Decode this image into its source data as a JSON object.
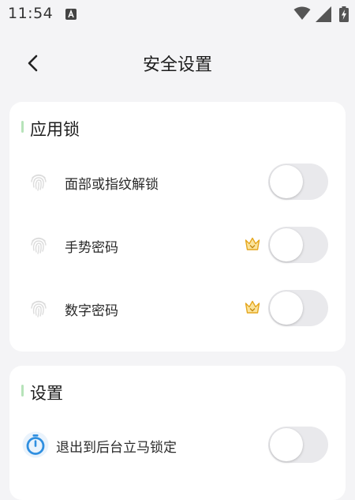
{
  "status_bar": {
    "time": "11:54",
    "icons": [
      "a-notification-icon",
      "wifi-icon",
      "cell-signal-icon",
      "battery-charging-icon"
    ]
  },
  "header": {
    "title": "安全设置",
    "back_icon": "chevron-left-icon"
  },
  "app_lock_section": {
    "title": "应用锁",
    "items": [
      {
        "label": "面部或指纹解锁",
        "icon": "fingerprint-icon",
        "premium": false,
        "enabled": false
      },
      {
        "label": "手势密码",
        "icon": "fingerprint-icon",
        "premium": true,
        "enabled": false
      },
      {
        "label": "数字密码",
        "icon": "fingerprint-icon",
        "premium": true,
        "enabled": false
      }
    ]
  },
  "settings_section": {
    "title": "设置",
    "items": [
      {
        "label": "退出到后台立马锁定",
        "icon": "stopwatch-icon",
        "enabled": false
      }
    ]
  },
  "colors": {
    "background": "#f4f4f6",
    "card": "#ffffff",
    "section_accent": "#b6e3b9",
    "toggle_off": "#e9e9ec",
    "stopwatch_blue": "#2f8fe0",
    "crown_gold": "#f0b636"
  }
}
